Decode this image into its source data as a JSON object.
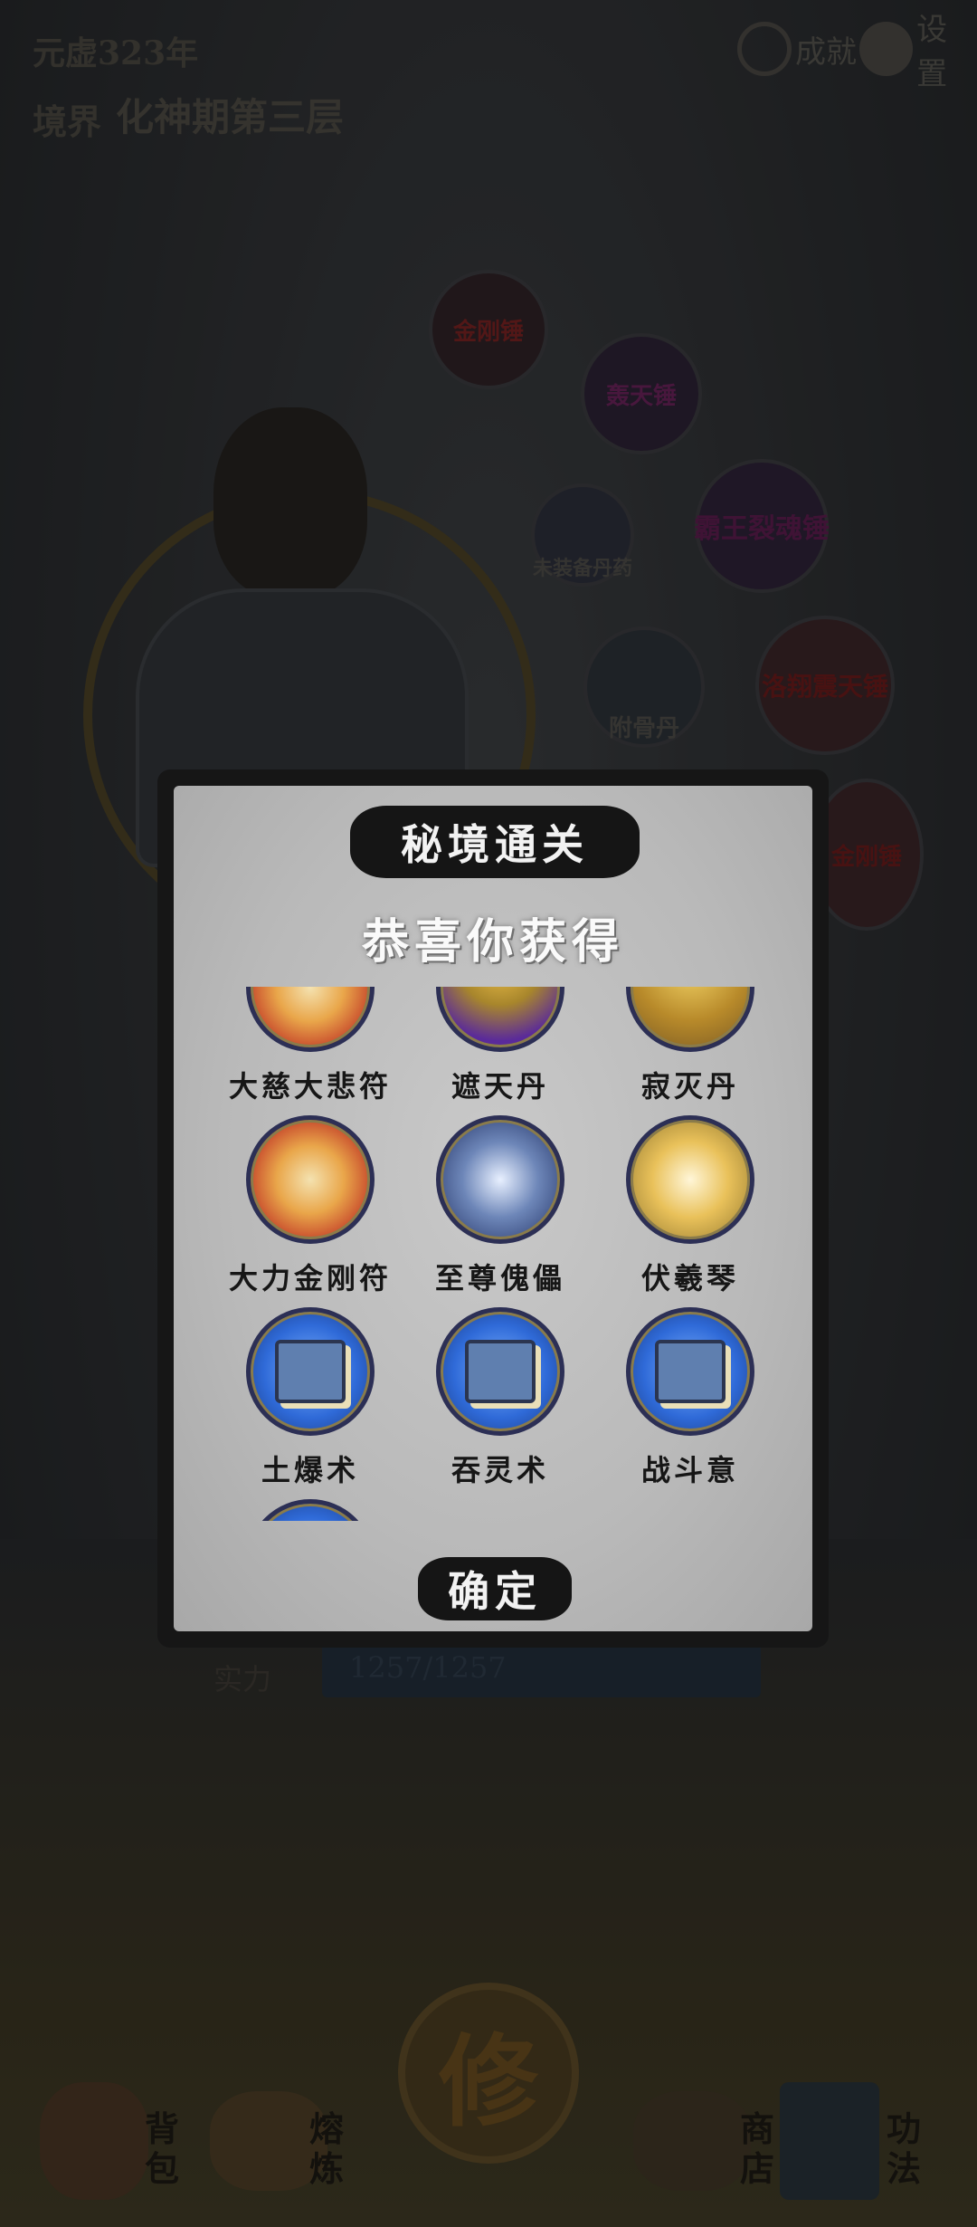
{
  "hud": {
    "era": "元虚323年",
    "realm_label": "境界",
    "realm_value": "化神期第三层",
    "achievements_label": "成就",
    "settings_label": "设置"
  },
  "skill_nodes": [
    {
      "label": "金刚锤"
    },
    {
      "label": "轰天锤"
    },
    {
      "label": "未装备丹药"
    },
    {
      "label": "霸王裂魂锤"
    },
    {
      "label": "附骨丹"
    },
    {
      "label": "洛翔震天锤"
    },
    {
      "label": "金刚锤"
    }
  ],
  "stat": {
    "label": "实力",
    "value": "1257/1257"
  },
  "modal": {
    "title": "秘境通关",
    "subtitle": "恭喜你获得",
    "confirm_label": "确定",
    "items": [
      {
        "name": "大慈大悲符",
        "icon": "talisman-icon"
      },
      {
        "name": "遮天丹",
        "icon": "purple-chest-pill-icon"
      },
      {
        "name": "寂灭丹",
        "icon": "golden-chest-pill-icon"
      },
      {
        "name": "大力金刚符",
        "icon": "talisman-icon"
      },
      {
        "name": "至尊傀儡",
        "icon": "puppet-icon"
      },
      {
        "name": "伏羲琴",
        "icon": "harp-icon"
      },
      {
        "name": "土爆术",
        "icon": "skill-book-icon"
      },
      {
        "name": "吞灵术",
        "icon": "skill-book-icon"
      },
      {
        "name": "战斗意",
        "icon": "skill-book-icon"
      },
      {
        "name": "",
        "icon": "skill-book-icon"
      }
    ]
  },
  "bottom_nav": {
    "bag": "背包",
    "forge": "熔炼",
    "cultivate": "修",
    "shop": "商店",
    "skills": "功法"
  }
}
